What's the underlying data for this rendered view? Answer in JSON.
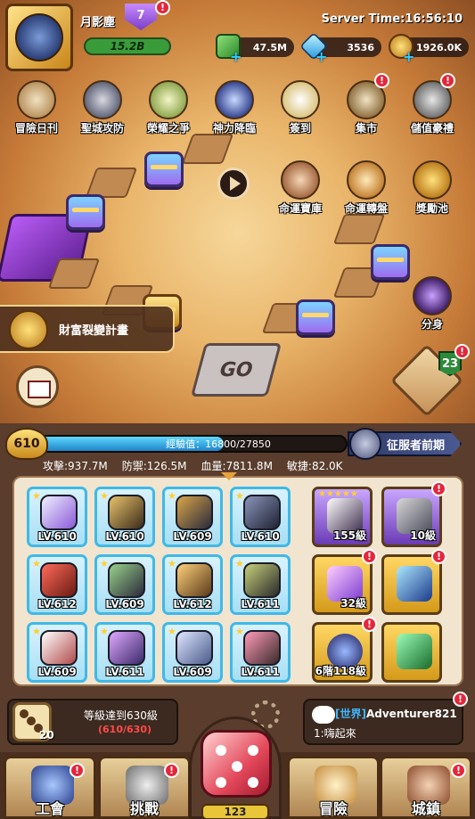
{
  "player": {
    "name": "月影塵",
    "vip": "7",
    "power": "15.2B"
  },
  "server_time": "Server Time:16:56:10",
  "resources": [
    {
      "name": "cash-icon",
      "value": "47.5M"
    },
    {
      "name": "diamond-icon",
      "value": "3536"
    },
    {
      "name": "coin-icon",
      "value": "1926.0K"
    }
  ],
  "top_menu": [
    {
      "label": "冒險日刊"
    },
    {
      "label": "聖城攻防"
    },
    {
      "label": "榮耀之爭"
    },
    {
      "label": "神力降臨"
    },
    {
      "label": "簽到"
    },
    {
      "label": "集市"
    },
    {
      "label": "儲值豪禮"
    }
  ],
  "side_menu": [
    {
      "label": "命運寶庫"
    },
    {
      "label": "命運轉盤"
    },
    {
      "label": "獎勵池"
    },
    {
      "label": "分身"
    }
  ],
  "board": {
    "go_label": "GO"
  },
  "wealth_plan": "財富裂變計畫",
  "map_level": "23",
  "level": "610",
  "xp": {
    "label": "經驗值：16800/27850",
    "fraction": 0.603
  },
  "rank": "征服者前期",
  "stats": [
    "攻擊:937.7M",
    "防禦:126.5M",
    "血量:7811.8M",
    "敏捷:82.0K"
  ],
  "equipment": [
    "LV.610",
    "LV.610",
    "LV.609",
    "LV.610",
    "LV.612",
    "LV.609",
    "LV.612",
    "LV.611",
    "LV.609",
    "LV.611",
    "LV.609",
    "LV.611"
  ],
  "right_items": [
    "155級",
    "10級",
    "32級",
    "",
    "6階118級",
    ""
  ],
  "dice": {
    "count": "20",
    "goal": "等級達到630級",
    "progress": "(610/630)",
    "main_count": "123"
  },
  "chat": {
    "channel": "[世界]",
    "user": "Adventurer821",
    "message": "1:嗨起來"
  },
  "nav": [
    {
      "label": "工會"
    },
    {
      "label": "挑戰"
    },
    {
      "label": "冒險"
    },
    {
      "label": "城鎮"
    }
  ],
  "colors": {
    "accent": "#3fb9e8",
    "badge": "#e5263b",
    "xp": "#1f83c8"
  }
}
